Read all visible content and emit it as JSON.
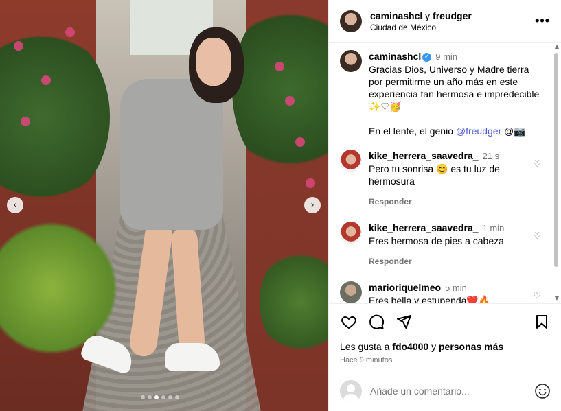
{
  "media": {
    "prev_label": "‹",
    "next_label": "›",
    "dots_total": 6,
    "dots_active": 2
  },
  "header": {
    "user1": "caminashcl",
    "and": "y",
    "user2": "freudger",
    "location": "Ciudad de México",
    "more": "•••"
  },
  "caption": {
    "username": "caminashcl",
    "verified_mark": "✓",
    "time": "9 min",
    "text": "Gracias Dios, Universo y Madre tierra por permitirme un año más en este experiencia tan hermosa e impredecible ✨♡🥳",
    "lens_text": "En el lente, el genio ",
    "lens_link": "@freudger",
    "lens_tail": " @📷"
  },
  "comments": [
    {
      "username": "kike_herrera_saavedra_",
      "time": "21 s",
      "text": "Pero tu sonrisa 😊 es tu luz de hermosura",
      "reply": "Responder"
    },
    {
      "username": "kike_herrera_saavedra_",
      "time": "1 min",
      "text": "Eres hermosa de pies a cabeza",
      "reply": "Responder"
    },
    {
      "username": "marioriquelmeo",
      "time": "5 min",
      "text": "Eres bella y estupenda❤️🔥",
      "reply": ""
    }
  ],
  "heart_small": "♡",
  "likes": {
    "prefix": "Les gusta a ",
    "user": "fdo4000",
    "middle": " y ",
    "others": "personas más"
  },
  "posted": "Hace 9 minutos",
  "comment_box": {
    "placeholder": "Añade un comentario..."
  },
  "scroll": {
    "up": "▲",
    "down": "▼"
  }
}
